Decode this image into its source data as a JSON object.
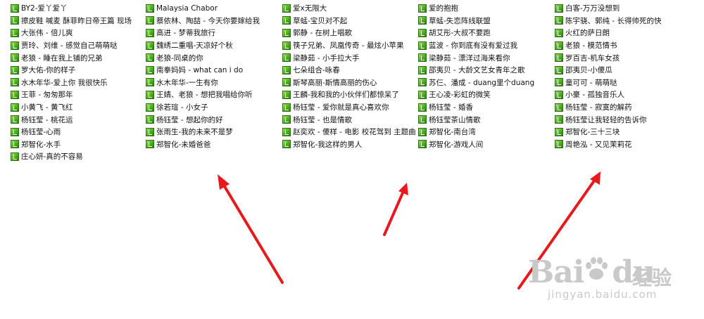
{
  "columns": [
    [
      "BY2-爱丫爱丫",
      "擦皮鞋 喊麦 酥菲昨日帝王篇 现场",
      "大张伟 - 倍儿爽",
      "贾玲、刘维 - 感觉自己萌萌哒",
      "老狼 - 睡在我上铺的兄弟",
      "罗大佑-你的样子",
      "水木年华-爱上你 我很快乐",
      "王菲 - 匆匆那年",
      "小黄飞 - 黄飞红",
      "杨钰莹 - 桃花运",
      "杨钰莹-心雨",
      "郑智化-水手",
      "庄心妍-真的不容易"
    ],
    [
      "Malaysia Chabor",
      "蔡依林、陶喆 - 今天你要嫁给我",
      "高进 - 梦蒂我旅行",
      "魏绣二重唱-天凉好个秋",
      "老狼-同桌的你",
      "南拳妈妈 - what can i do",
      "水木年华-一生有你",
      "王婧、老狼 - 想把我唱给你听",
      "徐若瑄 - 小女子",
      "杨钰莹 - 想起你的好",
      "张雨生-我的未来不是梦",
      "郑智化-未婚爸爸"
    ],
    [
      "爱x无限大",
      "草蜢-宝贝对不起",
      "郭静 - 在树上唱歌",
      "筷子兄弟、凤凰传奇 - 最炫小苹果",
      "梁静茹 - 小手拉大手",
      "七朵组合-咏春",
      "斯琴高丽-斯情高丽的伤心",
      "王麟-我和我的小伙伴们都惊呆了",
      "杨钰莹 - 爱你就是真心喜欢你",
      "杨钰莹 - 也是情歌",
      "赵奕欢 - 傻样 - 电影 校花驾到 主题曲",
      "郑智化-我这样的男人"
    ],
    [
      "爱的抱抱",
      "草蜢-失恋阵线联盟",
      "胡艾彤-大叔不要跑",
      "蓝波 - 你到底有没有爱过我",
      "梁静茹 - 漂洋过海来看你",
      "邵夷贝 - 大龄文艺女青年之歌",
      "苏仨、潘成 - duang里个duang",
      "王心凌-彩虹的微笑",
      "杨钰莹 - 婚香",
      "杨钰莹茶山情歌",
      "郑智化-南台湾",
      "郑智化-游戏人间"
    ],
    [
      "白客-万万没想到",
      "陈宇骁、郭纯 - 长得帅死的快",
      "火红的萨日朗",
      "老狼 - 模范情书",
      "罗百吉-机车女孩",
      "邵夷贝-小傻瓜",
      "童可可 - 萌萌哒",
      "小豪 - 孤独音乐人",
      "杨钰莹 - 寂寞的解药",
      "杨钰莹让我轻轻的告诉你",
      "郑智化-三十三块",
      "周艳泓 - 又见茉莉花"
    ]
  ],
  "icons": {
    "file": "music-file-icon"
  },
  "annotation": {
    "arrow_color": "#e8191c"
  },
  "watermark": {
    "logo": "Bai",
    "logo_tail": "du",
    "cn": "经验",
    "sub": "jingyan.baidu.com"
  }
}
